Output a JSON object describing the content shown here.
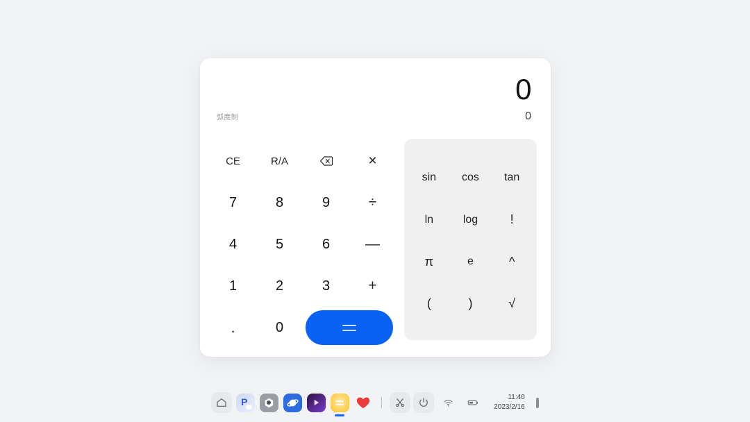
{
  "desktop": {
    "background_color": "#f2f3f5"
  },
  "calculator": {
    "display": {
      "primary_value": "0",
      "secondary_value": "0",
      "mode_label": "弧度制"
    },
    "accent_color": "#0a62f4",
    "keypad": [
      {
        "label": "CE",
        "name": "key-clear-entry",
        "kind": "func"
      },
      {
        "label": "R/A",
        "name": "key-ra",
        "kind": "func"
      },
      {
        "label": "",
        "name": "key-backspace",
        "kind": "icon",
        "icon": "backspace-icon"
      },
      {
        "label": "×",
        "name": "key-multiply",
        "kind": "op"
      },
      {
        "label": "7",
        "name": "key-7",
        "kind": "digit"
      },
      {
        "label": "8",
        "name": "key-8",
        "kind": "digit"
      },
      {
        "label": "9",
        "name": "key-9",
        "kind": "digit"
      },
      {
        "label": "÷",
        "name": "key-divide",
        "kind": "op"
      },
      {
        "label": "4",
        "name": "key-4",
        "kind": "digit"
      },
      {
        "label": "5",
        "name": "key-5",
        "kind": "digit"
      },
      {
        "label": "6",
        "name": "key-6",
        "kind": "digit"
      },
      {
        "label": "—",
        "name": "key-subtract",
        "kind": "op"
      },
      {
        "label": "1",
        "name": "key-1",
        "kind": "digit"
      },
      {
        "label": "2",
        "name": "key-2",
        "kind": "digit"
      },
      {
        "label": "3",
        "name": "key-3",
        "kind": "digit"
      },
      {
        "label": "+",
        "name": "key-add",
        "kind": "op"
      },
      {
        "label": ".",
        "name": "key-decimal",
        "kind": "dot"
      },
      {
        "label": "0",
        "name": "key-0",
        "kind": "digit"
      }
    ],
    "equals": {
      "label": "=",
      "name": "key-equals"
    },
    "scientific": [
      {
        "label": "sin",
        "name": "key-sin"
      },
      {
        "label": "cos",
        "name": "key-cos"
      },
      {
        "label": "tan",
        "name": "key-tan"
      },
      {
        "label": "ln",
        "name": "key-ln"
      },
      {
        "label": "log",
        "name": "key-log"
      },
      {
        "label": "!",
        "name": "key-factorial",
        "sym": true
      },
      {
        "label": "π",
        "name": "key-pi",
        "sym": true
      },
      {
        "label": "e",
        "name": "key-e"
      },
      {
        "label": "^",
        "name": "key-power",
        "sym": true
      },
      {
        "label": "(",
        "name": "key-open-paren",
        "sym": true
      },
      {
        "label": ")",
        "name": "key-close-paren",
        "sym": true
      },
      {
        "label": "√",
        "name": "key-sqrt",
        "sym": true
      }
    ]
  },
  "taskbar": {
    "apps": [
      {
        "name": "taskbar-home-icon",
        "icon": "home-icon"
      },
      {
        "name": "taskbar-files-icon",
        "icon": "files-icon"
      },
      {
        "name": "taskbar-settings-icon",
        "icon": "settings-icon"
      },
      {
        "name": "taskbar-browser-icon",
        "icon": "browser-icon"
      },
      {
        "name": "taskbar-video-icon",
        "icon": "video-player-icon"
      },
      {
        "name": "taskbar-calculator-icon",
        "icon": "calculator-icon",
        "active": true
      },
      {
        "name": "taskbar-health-icon",
        "icon": "heart-icon"
      }
    ],
    "tools": [
      {
        "name": "taskbar-screenshot-button",
        "icon": "scissors-icon"
      },
      {
        "name": "taskbar-power-button",
        "icon": "power-icon"
      }
    ],
    "status": [
      {
        "name": "wifi-icon",
        "icon": "wifi-icon"
      },
      {
        "name": "battery-icon",
        "icon": "battery-icon"
      }
    ],
    "clock": {
      "time": "11:40",
      "date": "2023/2/16"
    }
  }
}
